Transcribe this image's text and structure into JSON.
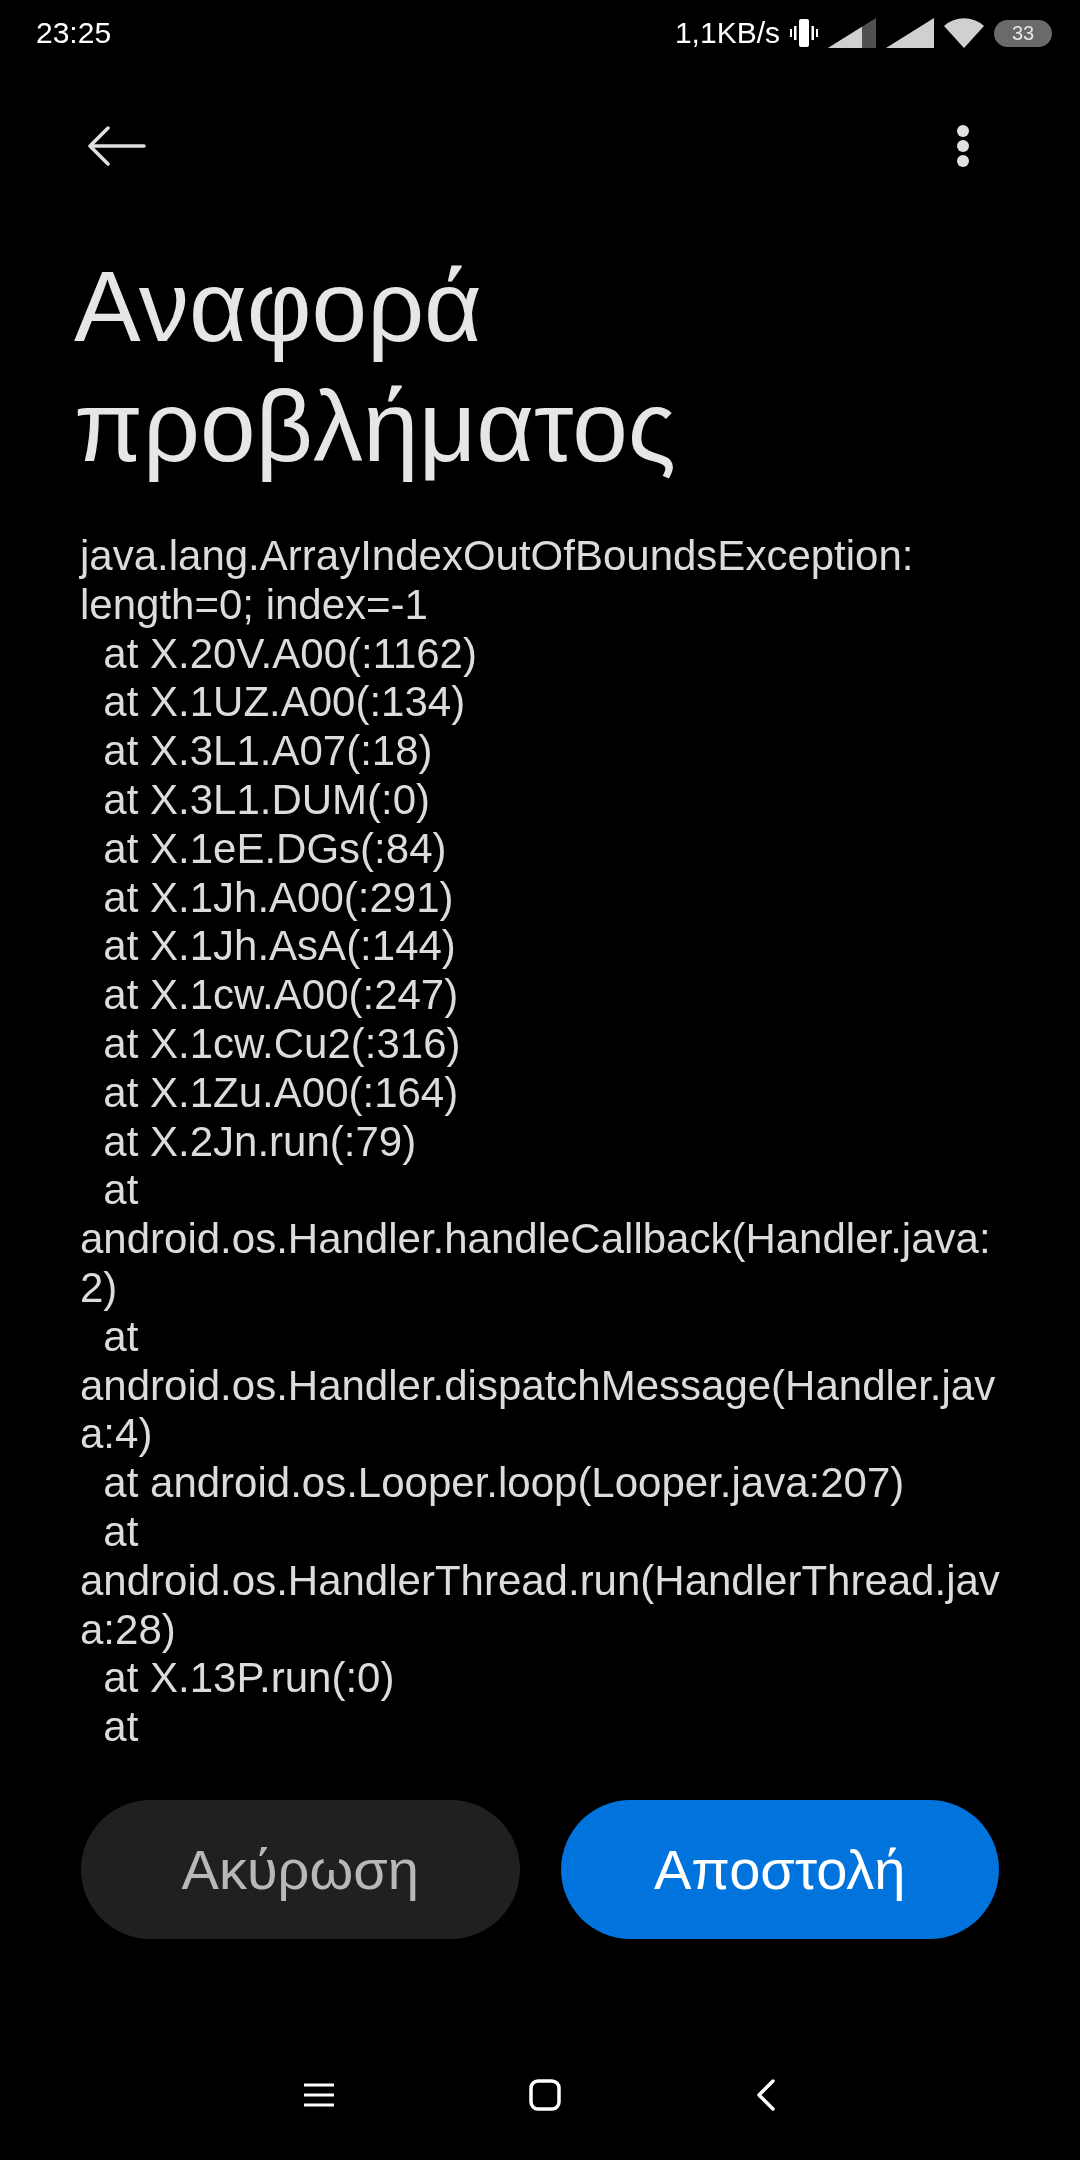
{
  "status_bar": {
    "time": "23:25",
    "network_speed": "1,1KB/s",
    "battery": "33"
  },
  "title": "Αναφορά προβλήματος",
  "report_lines": [
    "java.lang.ArrayIndexOutOfBoundsException:",
    "length=0; index=-1",
    "  at X.20V.A00(:1162)",
    "  at X.1UZ.A00(:134)",
    "  at X.3L1.A07(:18)",
    "  at X.3L1.DUM(:0)",
    "  at X.1eE.DGs(:84)",
    "  at X.1Jh.A00(:291)",
    "  at X.1Jh.AsA(:144)",
    "  at X.1cw.A00(:247)",
    "  at X.1cw.Cu2(:316)",
    "  at X.1Zu.A00(:164)",
    "  at X.2Jn.run(:79)",
    "  at",
    "android.os.Handler.handleCallback(Handler.java:",
    "2)",
    "  at",
    "android.os.Handler.dispatchMessage(Handler.jav",
    "a:4)",
    "  at android.os.Looper.loop(Looper.java:207)",
    "  at",
    "android.os.HandlerThread.run(HandlerThread.jav",
    "a:28)",
    "  at X.13P.run(:0)",
    "  at"
  ],
  "buttons": [
    {
      "label": "Ακύρωση",
      "kind": "secondary"
    },
    {
      "label": "Αποστολή",
      "kind": "primary"
    }
  ]
}
